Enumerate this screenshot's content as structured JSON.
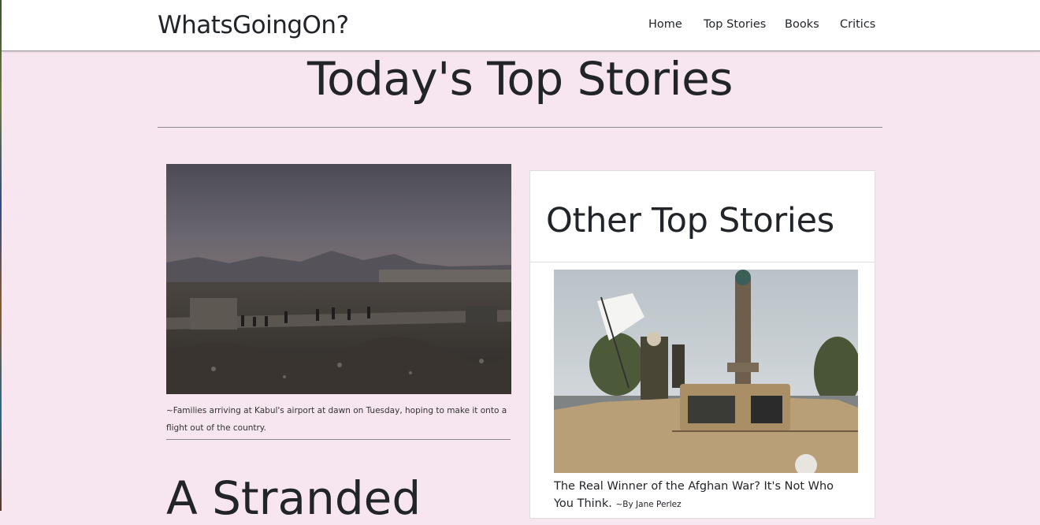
{
  "navbar": {
    "brand": "WhatsGoingOn?",
    "links": [
      "Home",
      "Top Stories",
      "Books",
      "Critics"
    ]
  },
  "main": {
    "page_title": "Today's Top Stories",
    "featured": {
      "image_icon": "photo-kabul-airport",
      "caption": "~Families arriving at Kabul's airport at dawn on Tuesday, hoping to make it onto a flight out of the country.",
      "headline": "A Stranded"
    }
  },
  "sidebar_card": {
    "title": "Other Top Stories",
    "story": {
      "image_icon": "photo-taliban-truck",
      "headline": "The Real Winner of the Afghan War? It's Not Who You Think.",
      "byline": "~By Jane Perlez"
    }
  },
  "colors": {
    "page_background": "#f7e6ef",
    "navbar_background": "#ffffff",
    "text": "#212529"
  }
}
